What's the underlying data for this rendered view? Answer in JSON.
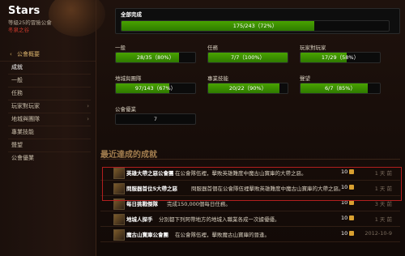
{
  "guild": {
    "name": "Stars",
    "level_line": "等級25的冒險公會",
    "realm": "冬泉之谷"
  },
  "nav": {
    "back": "公會概要",
    "items": [
      {
        "label": "成就",
        "active": true,
        "chev": false
      },
      {
        "label": "一般",
        "active": false,
        "chev": false
      },
      {
        "label": "任務",
        "active": false,
        "chev": false
      },
      {
        "label": "玩家對玩家",
        "active": false,
        "chev": true
      },
      {
        "label": "地城與團隊",
        "active": false,
        "chev": true
      },
      {
        "label": "專業技能",
        "active": false,
        "chev": false
      },
      {
        "label": "聲望",
        "active": false,
        "chev": false
      },
      {
        "label": "公會優業",
        "active": false,
        "chev": false
      }
    ]
  },
  "progress": {
    "total": {
      "label": "全部完成",
      "text": "175/243（72%）",
      "fraction": 0.72
    },
    "cards": [
      {
        "label": "一般",
        "text": "28/35（80%）",
        "fraction": 0.8
      },
      {
        "label": "任務",
        "text": "7/7（100%）",
        "fraction": 1.0
      },
      {
        "label": "玩家對玩家",
        "text": "17/29（58%）",
        "fraction": 0.58
      },
      {
        "label": "地城與團隊",
        "text": "97/143（67%）",
        "fraction": 0.67
      },
      {
        "label": "專業技能",
        "text": "20/22（90%）",
        "fraction": 0.9
      },
      {
        "label": "聲望",
        "text": "6/7（85%）",
        "fraction": 0.85
      }
    ],
    "guild": {
      "label": "公會優業",
      "value": "7"
    }
  },
  "recent": {
    "title": "最近達成的成就",
    "rows": [
      {
        "name": "英雄大帶之惡公會團",
        "desc": "在公會隊伍裡，擊敗英雄難度中魔古山寶庫的大帶之惡。",
        "points": "10",
        "date": "1 天 前"
      },
      {
        "name": "問服器首位5大帶之惡",
        "desc": "問服器首個在公會隊伍裡擊敗英雄難度中魔古山寶庫的大帶之惡。",
        "points": "10",
        "date": "1 天 前"
      },
      {
        "name": "每日挑戰傑隊",
        "desc": "完成150,000個每日任務。",
        "points": "10",
        "date": "3 天 前"
      },
      {
        "name": "地城人探手",
        "desc": "分別都下列阿帶地方的地城入職業各成一次據優優。",
        "points": "10",
        "date": "1 天 前"
      },
      {
        "name": "魔古山寶庫公會團",
        "desc": "在公會隊伍裡，擊敗魔古山寶庫的晉逢。",
        "points": "10",
        "date": "2012-10-9"
      }
    ]
  }
}
